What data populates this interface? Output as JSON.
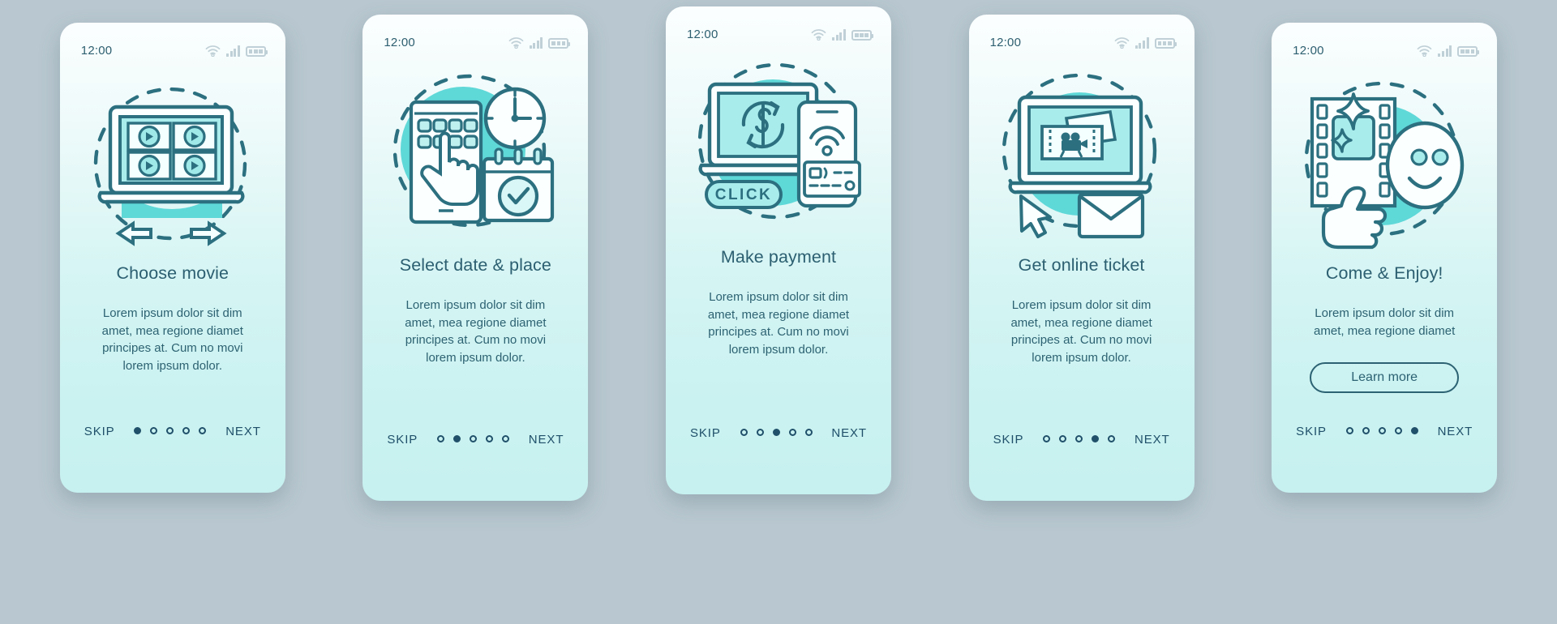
{
  "meta": {
    "background_color": "#b9c8d0",
    "accent_teal": "#5fd8d8",
    "line_color": "#2c7080",
    "text_color": "#2d6272",
    "nav_color": "#20506a"
  },
  "status_bar": {
    "time": "12:00",
    "icons": [
      "wifi-icon",
      "cellular-signal-icon",
      "battery-icon"
    ]
  },
  "nav": {
    "skip_label": "SKIP",
    "next_label": "NEXT",
    "dot_count": 5
  },
  "screens": [
    {
      "id": "choose-movie",
      "illustration": "laptop-movie-grid-with-arrows",
      "title": "Choose movie",
      "body": "Lorem ipsum dolor sit dim amet, mea regione diamet principes at. Cum no movi lorem ipsum dolor.",
      "active_dot": 1,
      "cta": null
    },
    {
      "id": "select-date-place",
      "illustration": "smartphone-seatmap-clock-calendar",
      "title": "Select date & place",
      "body": "Lorem ipsum dolor sit dim amet, mea regione diamet principes at. Cum no movi lorem ipsum dolor.",
      "active_dot": 2,
      "cta": null
    },
    {
      "id": "make-payment",
      "illustration": "laptop-dollar-refresh-phone-nfc-click",
      "illustration_label": "CLICK",
      "title": "Make payment",
      "body": "Lorem ipsum dolor sit dim amet, mea regione diamet principes at. Cum no movi lorem ipsum dolor.",
      "active_dot": 3,
      "cta": null
    },
    {
      "id": "get-online-ticket",
      "illustration": "laptop-tickets-cursor-envelope",
      "title": "Get online ticket",
      "body": "Lorem ipsum dolor sit dim amet, mea regione diamet principes at. Cum no movi lorem ipsum dolor.",
      "active_dot": 4,
      "cta": null
    },
    {
      "id": "come-and-enjoy",
      "illustration": "filmstrip-sparkles-heart-eyes-smiley-thumbs-up",
      "title": "Come & Enjoy!",
      "body": "Lorem ipsum dolor sit dim amet, mea regione diamet",
      "active_dot": 5,
      "cta": "Learn more"
    }
  ]
}
